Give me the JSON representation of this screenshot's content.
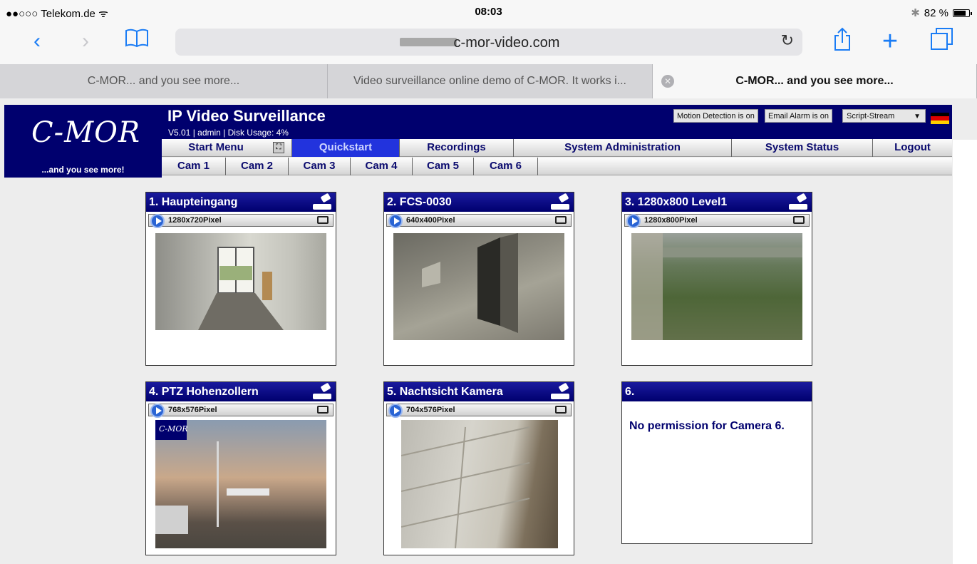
{
  "status": {
    "carrier": "●●○○○ Telekom.de ᯤ",
    "time": "08:03",
    "battery": "82 %",
    "battery_level": 0.82
  },
  "browser": {
    "url": "c-mor-video.com",
    "tabs": [
      {
        "label": "C-MOR... and you see more..."
      },
      {
        "label": "Video surveillance online demo of C-MOR. It works i..."
      },
      {
        "label": "C-MOR... and you see more..."
      }
    ]
  },
  "header": {
    "logo": "C-MOR",
    "slogan": "...and you see more!",
    "title": "IP Video Surveillance",
    "subtitle": "V5.01 | admin | Disk Usage: 4%",
    "motion": "Motion Detection is on",
    "email": "Email Alarm is on",
    "stream": "Script-Stream"
  },
  "nav": {
    "items": [
      "Start Menu",
      "Quickstart",
      "Recordings",
      "System Administration",
      "System Status",
      "Logout"
    ],
    "cams": [
      "Cam 1",
      "Cam 2",
      "Cam 3",
      "Cam 4",
      "Cam 5",
      "Cam 6"
    ]
  },
  "cameras": [
    {
      "title": "1. Haupteingang",
      "res": "1280x720Pixel"
    },
    {
      "title": "2. FCS-0030",
      "res": "640x400Pixel"
    },
    {
      "title": "3. 1280x800 Level1",
      "res": "1280x800Pixel"
    },
    {
      "title": "4. PTZ Hohenzollern",
      "res": "768x576Pixel"
    },
    {
      "title": "5. Nachtsicht Kamera",
      "res": "704x576Pixel"
    },
    {
      "title": "6.",
      "message": "No permission for Camera 6."
    }
  ],
  "colors": {
    "brand": "#00006e",
    "nav_active": "#2233dd",
    "ios_blue": "#1a7cf5"
  }
}
